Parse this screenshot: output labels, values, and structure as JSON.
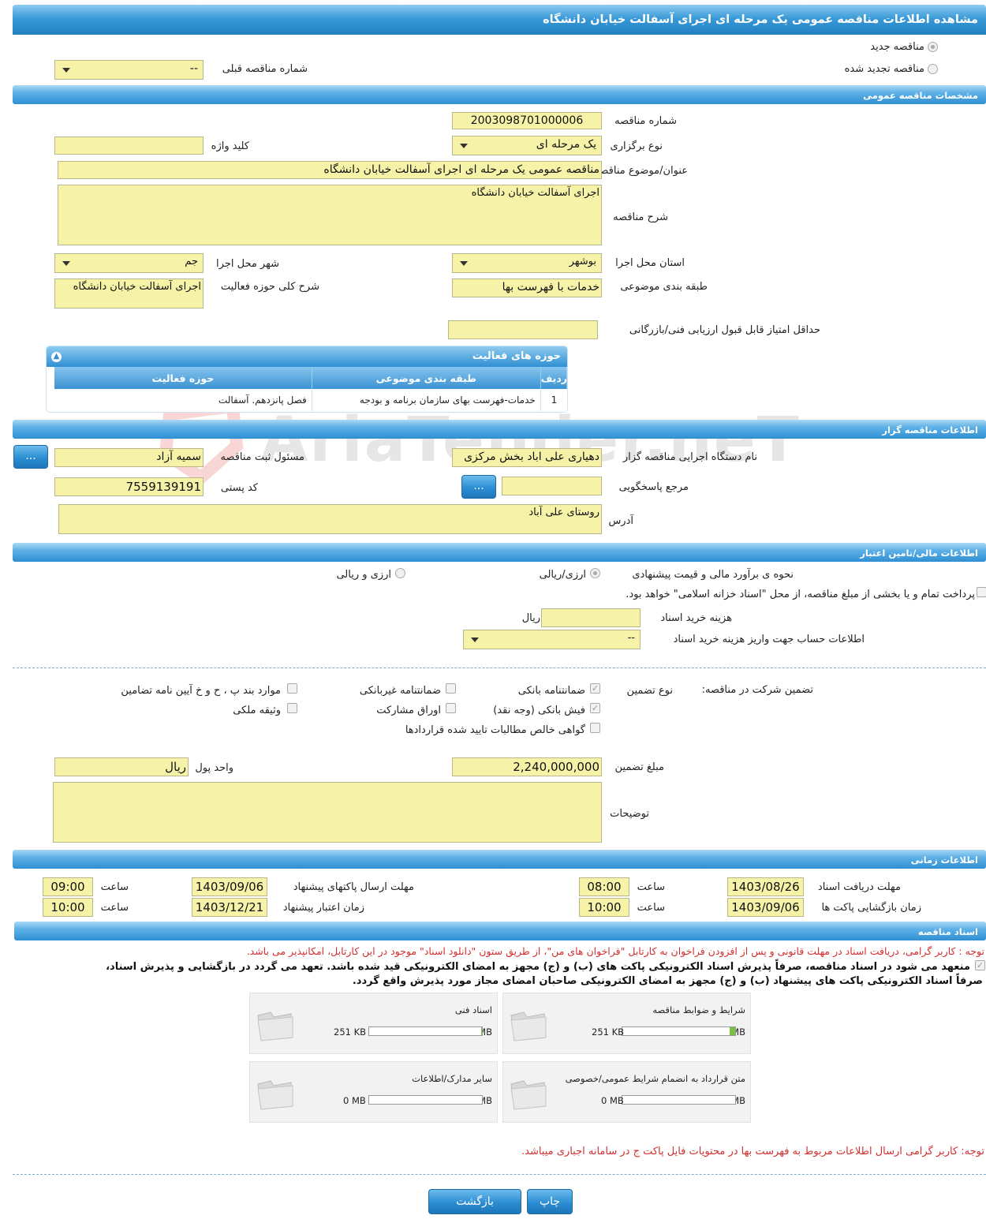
{
  "page_title": "مشاهده اطلاعات مناقصه عمومی یک مرحله ای اجرای آسفالت خیابان دانشگاه",
  "tender_type": {
    "new_label": "مناقصه جدید",
    "renewed_label": "مناقصه تجدید شده",
    "previous_label": "شماره مناقصه قبلی",
    "previous_value": "--"
  },
  "general": {
    "section_title": "مشخصات مناقصه عمومی",
    "number_label": "شماره مناقصه",
    "number_value": "2003098701000006",
    "holding_type_label": "نوع برگزاری",
    "holding_type_value": "یک مرحله ای",
    "keyword_label": "کلید واژه",
    "keyword_value": "",
    "title_label": "عنوان/موضوع مناقصه",
    "title_value": "مناقصه عمومی یک مرحله ای اجرای آسفالت خیابان دانشگاه",
    "description_label": "شرح مناقصه",
    "description_value": "اجرای آسفالت خیابان دانشگاه",
    "province_label": "استان محل اجرا",
    "province_value": "بوشهر",
    "city_label": "شهر محل اجرا",
    "city_value": "جم",
    "category_label": "طبقه بندی موضوعی",
    "category_value": "خدمات با فهرست بها",
    "activity_desc_label": "شرح کلی حوزه فعالیت",
    "activity_desc_value": "اجرای آسفالت خیابان دانشگاه",
    "min_score_label": "حداقل امتیاز قابل قبول ارزیابی فنی/بازرگانی",
    "min_score_value": ""
  },
  "activity_table": {
    "title": "حوزه های فعالیت",
    "headers": [
      "ردیف",
      "طبقه بندی موضوعی",
      "حوزه فعالیت"
    ],
    "rows": [
      [
        "1",
        "خدمات-فهرست بهای سازمان برنامه و بودجه",
        "فصل پانزدهم. آسفالت"
      ]
    ]
  },
  "organizer": {
    "section_title": "اطلاعات مناقصه گزار",
    "org_label": "نام دستگاه اجرایی مناقصه گزار",
    "org_value": "دهیاری علی اباد  بخش مرکزی",
    "registrar_label": "مسئول ثبت مناقصه",
    "registrar_value": "سمیه آزاد",
    "reference_label": "مرجع پاسخگویی",
    "reference_value": "",
    "postal_label": "کد پستی",
    "postal_value": "7559139191",
    "address_label": "آدرس",
    "address_value": "روستای علی آباد",
    "more_button": "..."
  },
  "finance": {
    "section_title": "اطلاعات مالی/تامین اعتبار",
    "estimate_label": "نحوه ی برآورد مالی و قیمت پیشنهادی",
    "opt_currency_rial": "ارزی/ریالی",
    "opt_currency_and_rial": "ارزی و ریالی",
    "treasury_text": "پرداخت تمام و یا بخشی از مبلغ مناقصه، از محل \"اسناد خزانه اسلامی\" خواهد بود.",
    "doc_cost_label": "هزینه خرید اسناد",
    "doc_cost_value": "",
    "doc_cost_unit": "ریال",
    "account_label": "اطلاعات حساب جهت واریز هزینه خرید اسناد",
    "account_value": "--"
  },
  "guarantee": {
    "label": "تضمین شرکت در مناقصه:",
    "type_label": "نوع تضمین",
    "options": [
      "ضمانتنامه بانکی",
      "ضمانتنامه غیربانکی",
      "موارد بند پ ، ح و خ آیین نامه تضامین",
      "فیش بانکی (وجه نقد)",
      "اوراق مشارکت",
      "وثیقه ملکی",
      "گواهی خالص مطالبات تایید شده قراردادها"
    ],
    "amount_label": "مبلغ تضمین",
    "amount_value": "2,240,000,000",
    "currency_label": "واحد پول",
    "currency_value": "ریال",
    "notes_label": "توضیحات",
    "notes_value": ""
  },
  "timing": {
    "section_title": "اطلاعات زمانی",
    "doc_receive_label": "مهلت دریافت اسناد",
    "doc_receive_date": "1403/08/26",
    "doc_receive_time": "08:00",
    "send_label": "مهلت ارسال پاکتهای پیشنهاد",
    "send_date": "1403/09/06",
    "send_time": "09:00",
    "open_label": "زمان بازگشایی پاکت ها",
    "open_date": "1403/09/06",
    "open_time": "10:00",
    "validity_label": "زمان اعتبار پیشنهاد",
    "validity_date": "1403/12/21",
    "validity_time": "10:00",
    "time_label": "ساعت"
  },
  "documents": {
    "section_title": "اسناد مناقصه",
    "notice": "توجه : کاربر گرامی، دریافت اسناد در مهلت قانونی و پس از افزودن فراخوان به کارتابل \"فراخوان های من\"، از طریق ستون \"دانلود اسناد\" موجود در این کارتابل، امکانپذیر می باشد.",
    "commit_line1": "منعهد می شود در اسناد مناقصه، صرفاً پذیرش اسناد الکترونیکی پاکت های (ب) و (ج) مجهز به امضای الکترونیکی قید شده باشد. تعهد می گردد در بازگشایی و پذیرش اسناد،",
    "commit_line2": "صرفاً اسناد الکترونیکی پاکت های پیشنهاد (ب) و (ج) مجهز به امضای الکترونیکی صاحبان امضای مجاز مورد پذیرش واقع گردد.",
    "items": [
      {
        "title": "شرایط و ضوابط مناقصه",
        "used": "251 KB",
        "max": "5 MB",
        "fill": 0.05
      },
      {
        "title": "اسناد فنی",
        "used": "251 KB",
        "max": "50 MB",
        "fill": 0.01
      },
      {
        "title": "متن قرارداد به انضمام شرایط عمومی/خصوصی",
        "used": "0 MB",
        "max": "5 MB",
        "fill": 0
      },
      {
        "title": "سایر مدارک/اطلاعات",
        "used": "0 MB",
        "max": "50 MB",
        "fill": 0
      }
    ],
    "footer_notice": "توجه: کاربر گرامی ارسال اطلاعات مربوط به فهرست بها در محتویات فایل پاکت ج در سامانه اجباری میباشد."
  },
  "watermark": "AriaTender.neT",
  "buttons": {
    "print": "چاپ",
    "back": "بازگشت"
  }
}
